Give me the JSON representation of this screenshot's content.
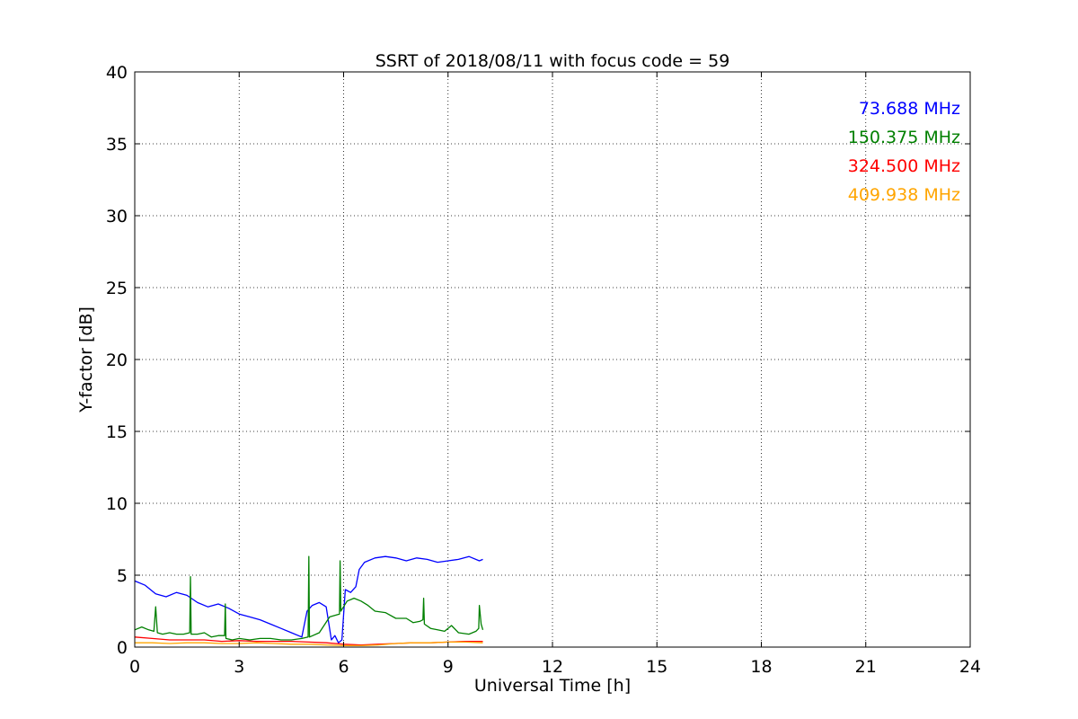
{
  "chart_data": {
    "type": "line",
    "title": "SSRT of 2018/08/11 with focus code = 59",
    "xlabel": "Universal Time [h]",
    "ylabel": "Y-factor [dB]",
    "xlim": [
      0,
      24
    ],
    "ylim": [
      0,
      40
    ],
    "xticks": [
      0,
      3,
      6,
      9,
      12,
      15,
      18,
      21,
      24
    ],
    "yticks": [
      0,
      5,
      10,
      15,
      20,
      25,
      30,
      35,
      40
    ],
    "grid": true,
    "legend_position": "top-right",
    "series": [
      {
        "name": "73.688 MHz",
        "color": "#0000ff",
        "x": [
          0.0,
          0.3,
          0.6,
          0.9,
          1.2,
          1.5,
          1.8,
          2.1,
          2.4,
          2.7,
          3.0,
          3.3,
          3.6,
          3.9,
          4.2,
          4.5,
          4.8,
          4.95,
          5.1,
          5.3,
          5.5,
          5.65,
          5.75,
          5.85,
          5.95,
          6.05,
          6.2,
          6.35,
          6.45,
          6.6,
          6.9,
          7.2,
          7.5,
          7.8,
          8.1,
          8.4,
          8.7,
          9.0,
          9.3,
          9.6,
          9.9,
          10.0
        ],
        "y": [
          4.6,
          4.3,
          3.7,
          3.5,
          3.8,
          3.6,
          3.1,
          2.8,
          3.0,
          2.7,
          2.3,
          2.1,
          1.9,
          1.6,
          1.3,
          1.0,
          0.7,
          2.5,
          2.9,
          3.1,
          2.8,
          0.5,
          0.8,
          0.3,
          0.5,
          4.0,
          3.8,
          4.2,
          5.4,
          5.9,
          6.2,
          6.3,
          6.2,
          6.0,
          6.2,
          6.1,
          5.9,
          6.0,
          6.1,
          6.3,
          6.0,
          6.1
        ]
      },
      {
        "name": "150.375 MHz",
        "color": "#008000",
        "x": [
          0.0,
          0.2,
          0.4,
          0.55,
          0.6,
          0.65,
          0.8,
          1.0,
          1.2,
          1.4,
          1.58,
          1.6,
          1.62,
          1.8,
          2.0,
          2.2,
          2.4,
          2.58,
          2.6,
          2.62,
          2.8,
          3.0,
          3.3,
          3.6,
          3.9,
          4.2,
          4.5,
          4.8,
          4.98,
          5.0,
          5.02,
          5.3,
          5.6,
          5.88,
          5.9,
          5.92,
          6.1,
          6.3,
          6.5,
          6.7,
          6.9,
          7.2,
          7.5,
          7.8,
          8.0,
          8.2,
          8.28,
          8.3,
          8.32,
          8.5,
          8.7,
          8.9,
          9.1,
          9.3,
          9.6,
          9.8,
          9.88,
          9.9,
          9.95,
          10.0
        ],
        "y": [
          1.2,
          1.4,
          1.2,
          1.1,
          2.8,
          1.0,
          0.9,
          1.0,
          0.9,
          0.9,
          1.0,
          4.9,
          0.9,
          0.9,
          1.0,
          0.7,
          0.8,
          0.8,
          3.0,
          0.6,
          0.5,
          0.6,
          0.5,
          0.6,
          0.6,
          0.5,
          0.5,
          0.6,
          0.7,
          6.3,
          0.7,
          1.0,
          2.1,
          2.3,
          6.0,
          2.5,
          3.2,
          3.4,
          3.2,
          2.9,
          2.5,
          2.4,
          2.0,
          2.0,
          1.7,
          1.8,
          1.9,
          3.4,
          1.6,
          1.3,
          1.2,
          1.1,
          1.5,
          1.0,
          0.9,
          1.1,
          1.3,
          2.9,
          1.6,
          1.2
        ]
      },
      {
        "name": "324.500 MHz",
        "color": "#ff0000",
        "x": [
          0.0,
          0.5,
          1.0,
          1.5,
          2.0,
          2.5,
          3.0,
          3.5,
          4.0,
          4.5,
          5.0,
          5.5,
          6.0,
          6.5,
          7.0,
          7.5,
          8.0,
          8.5,
          9.0,
          9.5,
          10.0
        ],
        "y": [
          0.7,
          0.6,
          0.5,
          0.5,
          0.5,
          0.4,
          0.45,
          0.4,
          0.4,
          0.4,
          0.35,
          0.3,
          0.2,
          0.15,
          0.2,
          0.25,
          0.3,
          0.3,
          0.35,
          0.4,
          0.4
        ]
      },
      {
        "name": "409.938 MHz",
        "color": "#ffa500",
        "x": [
          0.0,
          0.5,
          1.0,
          1.5,
          2.0,
          2.5,
          3.0,
          3.5,
          4.0,
          4.5,
          5.0,
          5.5,
          6.0,
          6.5,
          7.0,
          7.5,
          8.0,
          8.5,
          9.0,
          9.5,
          10.0
        ],
        "y": [
          0.3,
          0.3,
          0.25,
          0.3,
          0.3,
          0.25,
          0.25,
          0.3,
          0.25,
          0.2,
          0.2,
          0.15,
          0.1,
          0.1,
          0.15,
          0.25,
          0.3,
          0.3,
          0.35,
          0.35,
          0.3
        ]
      }
    ]
  }
}
